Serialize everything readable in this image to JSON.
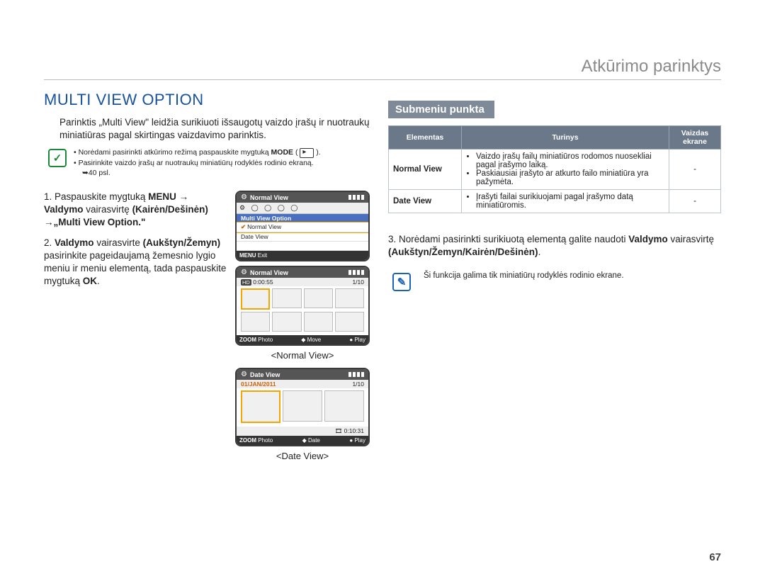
{
  "header": {
    "chapter": "Atkūrimo parinktys"
  },
  "section_title": "MULTI VIEW OPTION",
  "intro": "Parinktis „Multi View\" leidžia surikiuoti išsaugotų vaizdo įrašų ir nuotraukų miniatiūras pagal skirtingas vaizdavimo parinktis.",
  "top_note": {
    "b1_pre": "Norėdami pasirinkti atkūrimo režimą paspauskite mygtuką ",
    "b1_bold": "MODE",
    "b1_post": " ( ",
    "b2": "Pasirinkite vaizdo įrašų ar nuotraukų miniatiūrų rodyklės rodinio ekraną.",
    "b2_sub": "➥40 psl."
  },
  "step1": {
    "num": "1.",
    "t1": "Paspauskite mygtuką ",
    "b1": "MENU",
    "arrow": " → ",
    "b2": "Valdymo",
    "t2": " vairasvirtę ",
    "b3": "(Kairėn/Dešinėn)",
    "arrow2": " →",
    "b4": "„Multi View Option.\""
  },
  "step2": {
    "num": "2.",
    "b1": "Valdymo",
    "t1": " vairasvirte ",
    "b2": "(Aukštyn/Žemyn)",
    "t2": " pasirinkite pageidaujamą žemesnio lygio meniu ir meniu elementą, tada paspauskite mygtuką ",
    "b3": "OK",
    "t3": "."
  },
  "step3": {
    "num": "3.",
    "t1": "Norėdami pasirinkti surikiuotą elementą galite naudoti ",
    "b1": "Valdymo",
    "t2": " vairasvirtę ",
    "b2": "(Aukštyn/Žemyn/Kairėn/Dešinėn)",
    "t3": "."
  },
  "fig1": {
    "top": "Normal View",
    "menu_header": "Multi View Option",
    "menu_sel": "Normal View",
    "menu_item": "Date View",
    "foot_l": "MENU",
    "foot_l2": "Exit"
  },
  "fig2": {
    "top": "Normal View",
    "time": "0:00:55",
    "count": "1/10",
    "foot_l": "ZOOM",
    "foot_1": "Photo",
    "foot_2": "Move",
    "foot_3": "Play",
    "label": "<Normal View>"
  },
  "fig3": {
    "top": "Date View",
    "date": "01/JAN/2011",
    "count": "1/10",
    "dur": "0:10:31",
    "foot_l": "ZOOM",
    "foot_1": "Photo",
    "foot_2": "Date",
    "foot_3": "Play",
    "label": "<Date View>"
  },
  "subhead": "Submeniu punkta",
  "table": {
    "h1": "Elementas",
    "h2": "Turinys",
    "h3": "Vaizdas ekrane",
    "r1_name": "Normal View",
    "r1_li1": "Vaizdo įrašų failų miniatiūros rodomos nuosekliai pagal įrašymo laiką.",
    "r1_li2": "Paskiausiai įrašyto ar atkurto failo miniatiūra yra pažymėta.",
    "r1_img": "-",
    "r2_name": "Date View",
    "r2_li1": "Įrašyti failai surikiuojami pagal įrašymo datą miniatiūromis.",
    "r2_img": "-"
  },
  "note2": "Ši funkcija galima tik miniatiūrų rodyklės rodinio ekrane.",
  "page_number": "67"
}
